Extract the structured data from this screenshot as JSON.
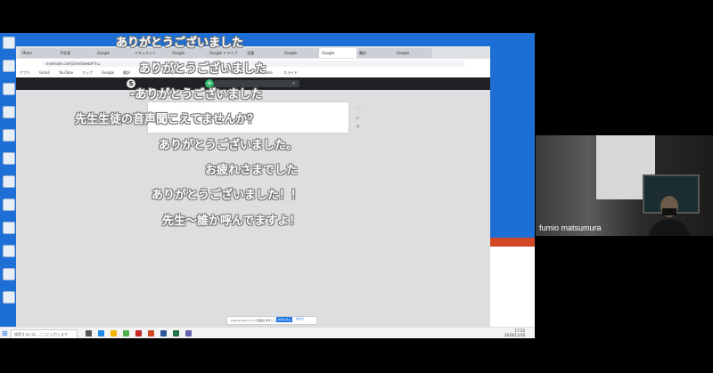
{
  "comments": [
    "ありがとうございました",
    "ありがとうございました",
    "-ありがとうございました",
    "先生生徒の音声聞こえてませんか？",
    "ありがとうございました。",
    "お疲れさまでした",
    "ありがとうございました！！",
    "先生〜誰か呼んでますよ！"
  ],
  "browser": {
    "tabs": [
      "Moon",
      "予定表",
      "Google",
      "ドキュメント",
      "Google",
      "Google ドライブ",
      "会議",
      "Google",
      "Google",
      "翻訳",
      "Google"
    ],
    "address": "evernote.com/client/web#?n=",
    "bookmarks": [
      "アプリ",
      "Gmail",
      "YouTube",
      "マップ",
      "Google",
      "翻訳",
      "ニュース",
      "Google ドライブ",
      "カレンダー",
      "ドキュメント",
      "Evernote",
      "スライド"
    ],
    "app_logo": "S",
    "add_symbol": "+",
    "dialog_text": "www.google.com で画面を共有しています",
    "dialog_button": "共有を停止",
    "dialog_cancel": "非表示"
  },
  "taskbar": {
    "search_placeholder": "検索するには、ここに入力します",
    "time": "17:52",
    "date": "2020/11/16"
  },
  "webcam": {
    "participant_name": "fumio matsumura"
  },
  "colors": {
    "app_bar": "#1f2124",
    "accent_green": "#2fb36b",
    "desktop_blue": "#1d6fd6",
    "dialog_button": "#1a73e8"
  }
}
